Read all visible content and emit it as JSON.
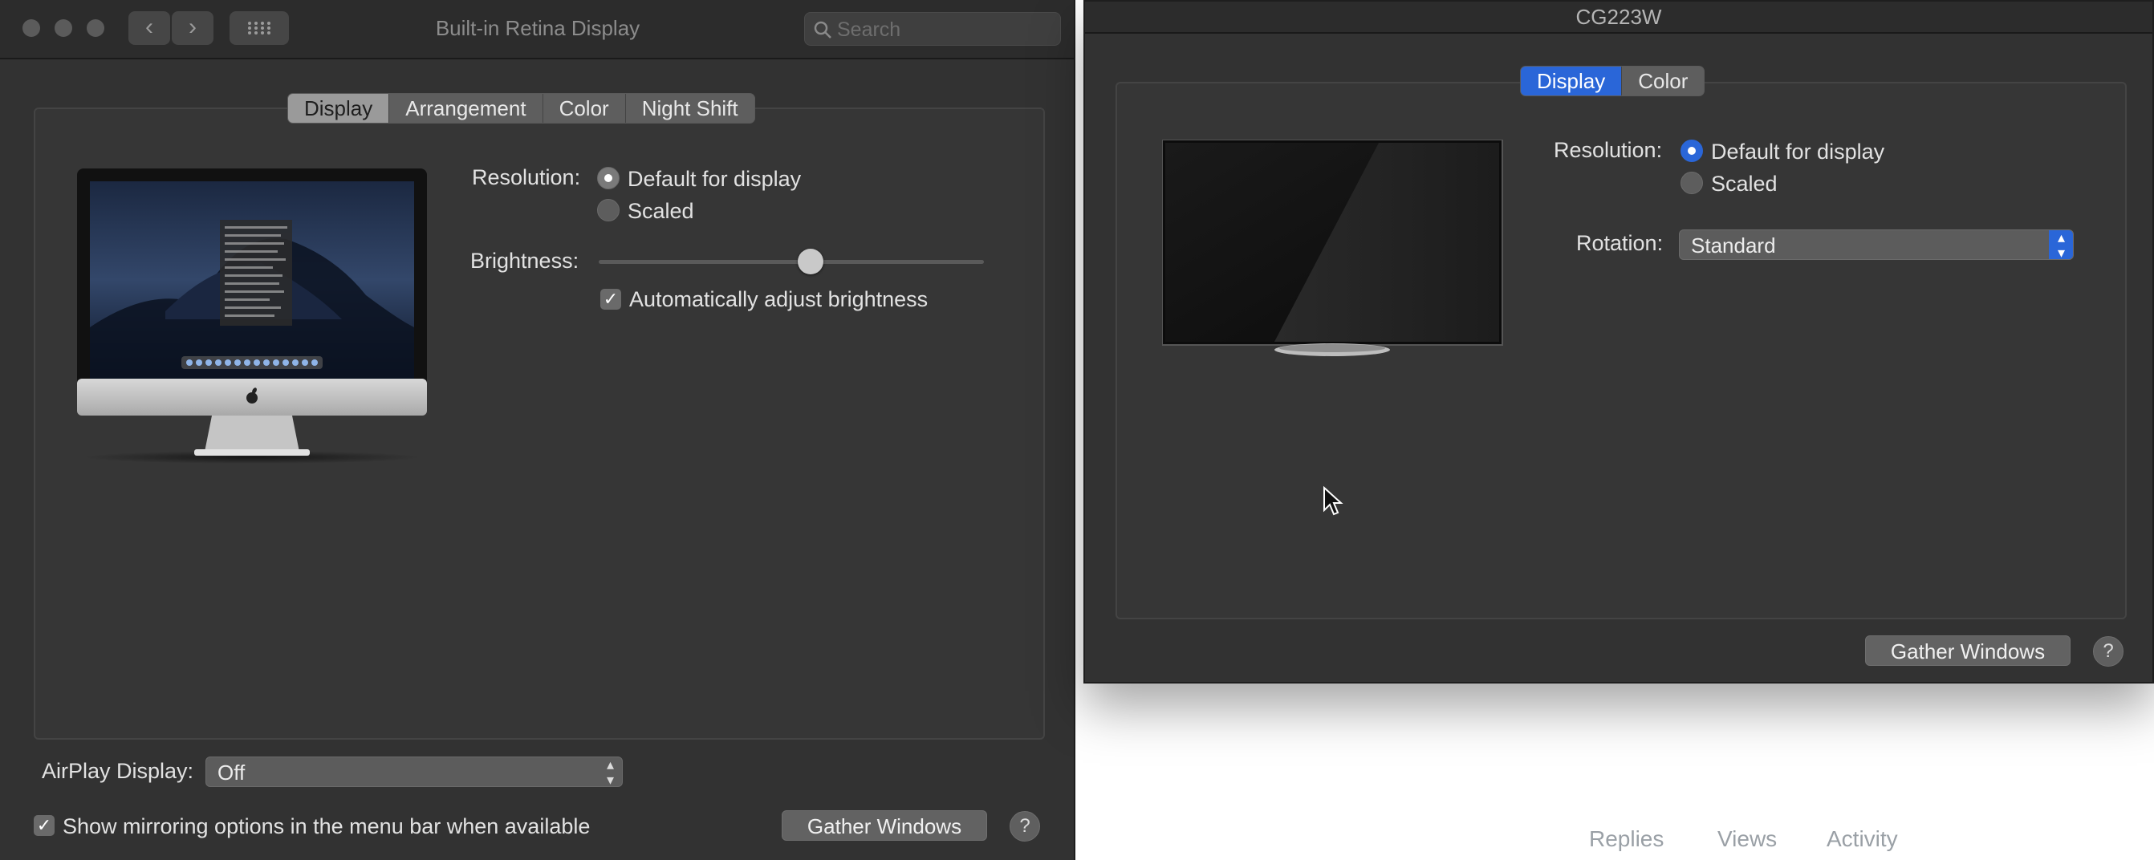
{
  "left_window": {
    "title": "Built-in Retina Display",
    "search_placeholder": "Search",
    "tabs": [
      {
        "label": "Display",
        "selected": true
      },
      {
        "label": "Arrangement",
        "selected": false
      },
      {
        "label": "Color",
        "selected": false
      },
      {
        "label": "Night Shift",
        "selected": false
      }
    ],
    "resolution_label": "Resolution:",
    "resolution_options": [
      {
        "label": "Default for display",
        "selected": true
      },
      {
        "label": "Scaled",
        "selected": false
      }
    ],
    "brightness_label": "Brightness:",
    "brightness_value": 0.55,
    "auto_brightness_label": "Automatically adjust brightness",
    "auto_brightness_checked": true,
    "airplay_label": "AirPlay Display:",
    "airplay_value": "Off",
    "mirroring_label": "Show mirroring options in the menu bar when available",
    "mirroring_checked": true,
    "gather_windows_label": "Gather Windows",
    "help_label": "?"
  },
  "right_window": {
    "title": "CG223W",
    "tabs": [
      {
        "label": "Display",
        "selected": true
      },
      {
        "label": "Color",
        "selected": false
      }
    ],
    "resolution_label": "Resolution:",
    "resolution_options": [
      {
        "label": "Default for display",
        "selected": true
      },
      {
        "label": "Scaled",
        "selected": false
      }
    ],
    "rotation_label": "Rotation:",
    "rotation_value": "Standard",
    "gather_windows_label": "Gather Windows",
    "help_label": "?"
  },
  "background_page": {
    "footer_items": [
      "Replies",
      "Views",
      "Activity"
    ]
  },
  "colors": {
    "window_bg": "#323232",
    "accent_blue": "#2a66d8"
  }
}
